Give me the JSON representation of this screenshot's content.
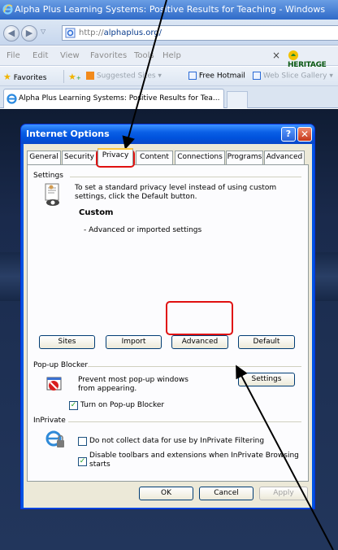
{
  "browser": {
    "title": "Alpha Plus Learning Systems: Positive Results for Teaching - Windows",
    "url_protocol": "http://",
    "url_host": "alphaplus.org/",
    "menu": [
      "File",
      "Edit",
      "View",
      "Favorites",
      "Tools",
      "Help"
    ],
    "close_glyph": "×",
    "heritage_label": "HERITAGE",
    "favorites": {
      "favorites_label": "Favorites",
      "suggested": "Suggested Sites ▾",
      "hotmail": "Free Hotmail",
      "webslice": "Web Slice Gallery ▾"
    },
    "tab_title": "Alpha Plus Learning Systems: Positive Results for Tea..."
  },
  "dialog": {
    "title": "Internet Options",
    "help_glyph": "?",
    "close_glyph": "✕",
    "tabs": [
      "General",
      "Security",
      "Privacy",
      "Content",
      "Connections",
      "Programs",
      "Advanced"
    ],
    "selected_tab": "Privacy",
    "settings": {
      "header": "Settings",
      "description": "To set a standard privacy level instead of using custom settings, click the Default button.",
      "level": "Custom",
      "level_detail": "- Advanced or imported settings",
      "buttons": {
        "sites": "Sites",
        "import": "Import",
        "advanced": "Advanced",
        "default": "Default"
      }
    },
    "popup": {
      "header": "Pop-up Blocker",
      "description": "Prevent most pop-up windows from appearing.",
      "settings_button": "Settings",
      "checkbox_label": "Turn on Pop-up Blocker",
      "checked": true
    },
    "inprivate": {
      "header": "InPrivate",
      "option1": "Do not collect data for use by InPrivate Filtering",
      "option1_checked": false,
      "option2": "Disable toolbars and extensions when InPrivate Browsing starts",
      "option2_checked": true
    },
    "footer": {
      "ok": "OK",
      "cancel": "Cancel",
      "apply": "Apply"
    }
  },
  "colors": {
    "title_bar_blue": "#0054e3",
    "dialog_face": "#ece9d8",
    "highlight_red": "#e01010",
    "page_background": "#1a2a4c"
  }
}
